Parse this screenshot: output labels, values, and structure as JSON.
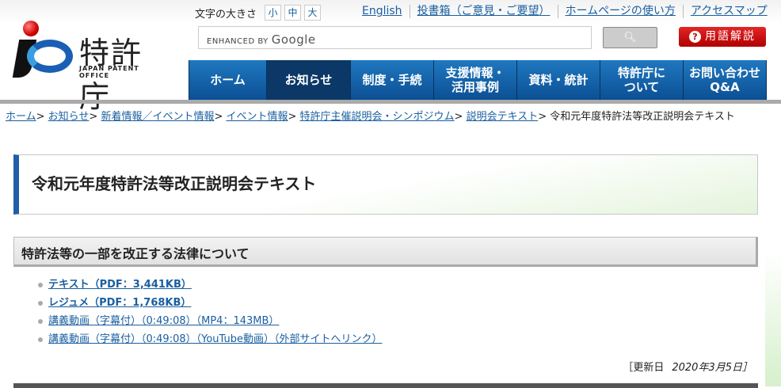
{
  "logo": {
    "kanji": "特許庁",
    "english": "JAPAN PATENT OFFICE"
  },
  "font_size": {
    "label": "文字の大きさ",
    "small": "小",
    "medium": "中",
    "large": "大"
  },
  "top_links": [
    "English",
    "投書箱（ご意見・ご要望）",
    "ホームページの使い方",
    "アクセスマップ"
  ],
  "search": {
    "placeholder_prefix": "ENHANCED BY",
    "placeholder_brand": "Google",
    "button_icon": "search-icon"
  },
  "glossary": {
    "icon": "?",
    "label": "用語解説"
  },
  "nav": [
    {
      "label": "ホーム"
    },
    {
      "label": "お知らせ",
      "active": true
    },
    {
      "label": "制度・手続"
    },
    {
      "label": "支援情報・活用事例"
    },
    {
      "label": "資料・統計"
    },
    {
      "label": "特許庁について"
    },
    {
      "label": "お問い合わせQ&A"
    }
  ],
  "breadcrumb": [
    "ホーム",
    "お知らせ",
    "新着情報／イベント情報",
    "イベント情報",
    "特許庁主催説明会・シンポジウム",
    "説明会テキスト"
  ],
  "breadcrumb_current": "令和元年度特許法等改正説明会テキスト",
  "page_title": "令和元年度特許法等改正説明会テキスト",
  "section_title": "特許法等の一部を改正する法律について",
  "links": [
    "テキスト（PDF：3,441KB）",
    "レジュメ（PDF：1,768KB）",
    "講義動画（字幕付）（0:49:08）（MP4：143MB）",
    "講義動画（字幕付）（0:49:08）（YouTube動画）（外部サイトへリンク）"
  ],
  "updated": {
    "label": "［更新日",
    "date": "2020年3月5日］"
  }
}
